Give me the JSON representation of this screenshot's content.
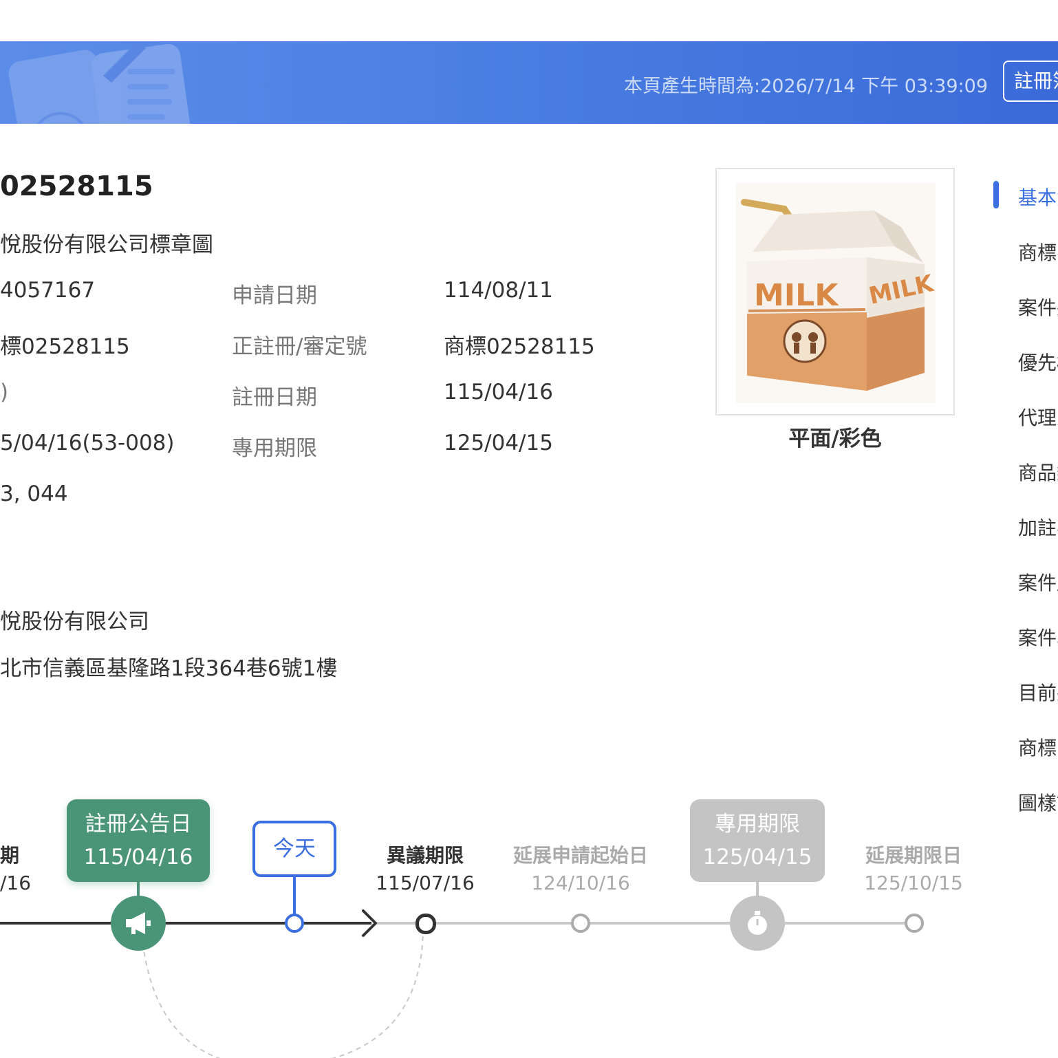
{
  "header": {
    "generated_time": "本頁產生時間為:2026/7/14 下午 03:39:09",
    "register_button": "註冊簿"
  },
  "trademark": {
    "number": "02528115",
    "name": "悅股份有限公司標章圖",
    "fields_left": [
      "4057167",
      "標02528115",
      ")",
      "5/04/16(53-008)",
      "3, 044"
    ],
    "labels_mid": [
      "申請日期",
      "正註冊/審定號",
      "註冊日期",
      "專用期限"
    ],
    "values_right": [
      "114/08/11",
      "商標02528115",
      "115/04/16",
      "125/04/15"
    ],
    "owner": "悅股份有限公司",
    "address": "北市信義區基隆路1段364巷6號1樓"
  },
  "image": {
    "milk_text_left": "MILK",
    "milk_text_right": "MILK",
    "caption": "平面/彩色"
  },
  "nav": {
    "items": [
      "基本資",
      "商標名",
      "案件狀",
      "優先權",
      "代理人",
      "商品類",
      "加註事",
      "案件歷",
      "案件異",
      "目前狀",
      "商標圖",
      "圖樣說"
    ]
  },
  "timeline": {
    "first_label_title": "期",
    "first_label_date": "/16",
    "reg_notice_title": "註冊公告日",
    "reg_notice_date": "115/04/16",
    "today": "今天",
    "objection_title": "異議期限",
    "objection_date": "115/07/16",
    "ext_start_title": "延展申請起始日",
    "ext_start_date": "124/10/16",
    "exclusive_title": "專用期限",
    "exclusive_date": "125/04/15",
    "ext_end_title": "延展期限日",
    "ext_end_date": "125/10/15"
  },
  "colors": {
    "banner": "#4a7fe2",
    "accent": "#3b6fe0",
    "green": "#4a9478",
    "grey": "#c4c4c4"
  }
}
